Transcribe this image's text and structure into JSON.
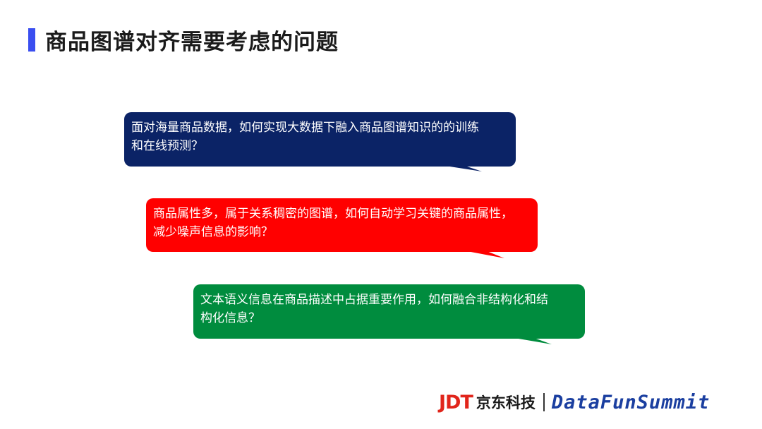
{
  "slide": {
    "title": "商品图谱对齐需要考虑的问题",
    "accent_color": "#3a4ef0"
  },
  "bubbles": [
    {
      "line1": "面对海量商品数据，如何实现大数据下融入商品图谱知识的的训练",
      "line2": "和在线预测？",
      "color": "#0b2366"
    },
    {
      "line1": "商品属性多，属于关系稠密的图谱，如何自动学习关键的商品属性，",
      "line2": "减少噪声信息的影响？",
      "color": "#ff0000"
    },
    {
      "line1": "文本语义信息在商品描述中占据重要作用，如何融合非结构化和结",
      "line2": "构化信息？",
      "color": "#008c3e"
    }
  ],
  "footer": {
    "jdt": "JDT",
    "company": "京东科技",
    "brand": "DataFunSummit"
  }
}
